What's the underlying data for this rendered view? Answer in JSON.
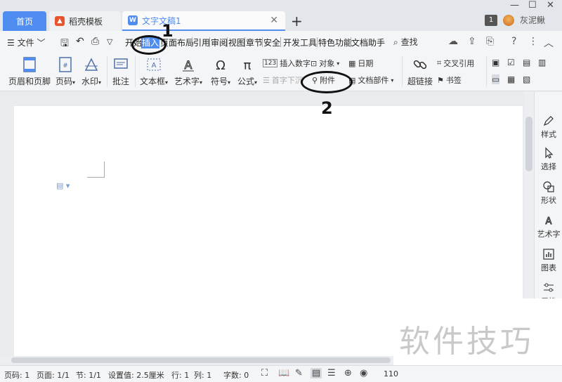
{
  "tabs": {
    "home": "首页",
    "template": "稻壳模板",
    "document": "文字文稿1"
  },
  "user": {
    "badge": "1",
    "name": "灰泥鳅"
  },
  "menu": {
    "file": "文件",
    "tabs": [
      "开始",
      "插入",
      "页面布局",
      "引用",
      "审阅",
      "视图",
      "章节",
      "安全",
      "开发工具",
      "特色功能",
      "文档助手"
    ],
    "search": "查找"
  },
  "ribbon": {
    "header_footer": "页眉和页脚",
    "page_num": "页码",
    "watermark": "水印",
    "comment": "批注",
    "textbox": "文本框",
    "wordart": "艺术字",
    "symbol": "符号",
    "formula": "公式",
    "insert_number": "插入数字",
    "object": "对象",
    "date": "日期",
    "dropcap": "首字下沉",
    "attachment": "附件",
    "doc_parts": "文档部件",
    "hyperlink": "超链接",
    "cross_ref": "交叉引用",
    "bookmark": "书签"
  },
  "right_panel": [
    "样式",
    "选择",
    "形状",
    "艺术字",
    "图表",
    "属性"
  ],
  "status": {
    "page_code": "页码: 1",
    "page": "页面: 1/1",
    "section": "节: 1/1",
    "setting": "设置值: 2.5厘米",
    "row": "行: 1",
    "col": "列: 1",
    "chars": "字数: 0",
    "zoom": "110"
  },
  "annotations": {
    "step1": "1",
    "step2": "2"
  },
  "watermark_text": "软件技巧"
}
